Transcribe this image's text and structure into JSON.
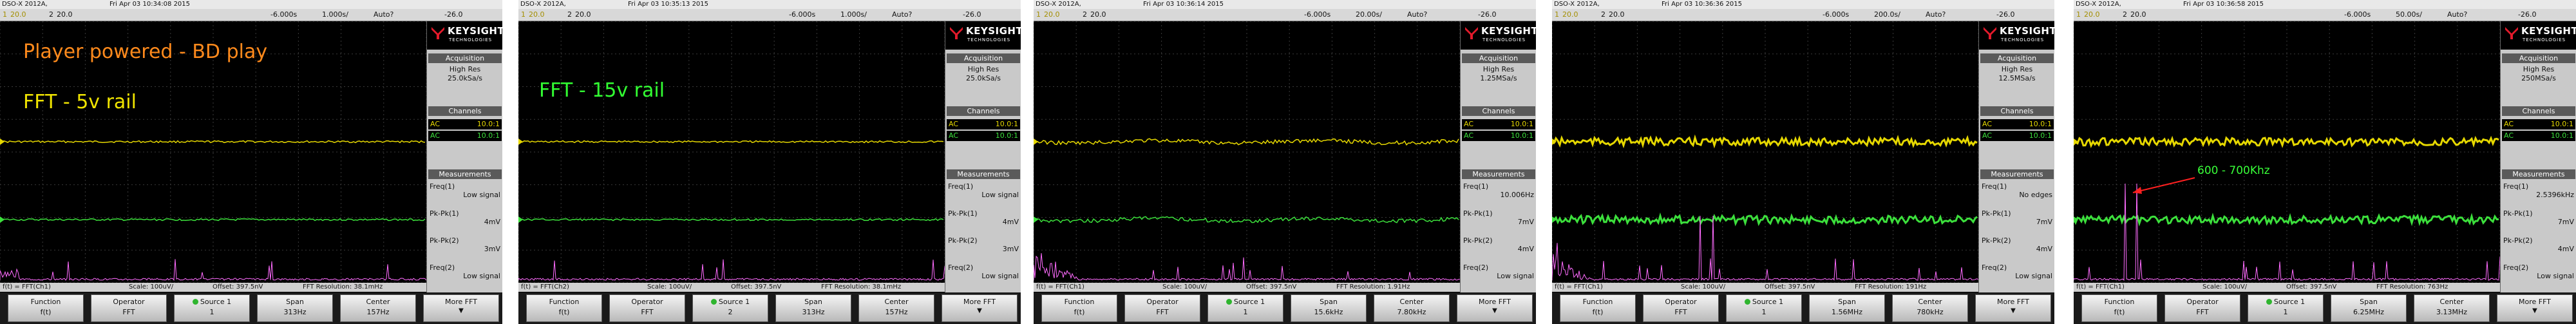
{
  "screens": [
    {
      "status": {
        "model": "DSO-X 2012A,",
        "datetime": "Fri Apr 03 10:34:08 2015"
      },
      "topbar": {
        "ch1": "1",
        "ch1_scale": "20.0",
        "ch2": "2",
        "ch2_scale": "20.0",
        "time_pos": "-6.000s",
        "time_scale": "1.000s/",
        "trigger": "Auto?",
        "trig_level": "-26.0"
      },
      "notes": [
        {
          "text": "Player powered - BD play",
          "color": "orange"
        },
        {
          "text": "FFT - 5v rail",
          "color": "yellow"
        }
      ],
      "peak_label": "",
      "bottom": {
        "channel": "f(t) = FFT(Ch1)",
        "scale": "Scale: 100uV/",
        "offset": "Offset: 397.5nV",
        "resolution": "FFT Resolution: 38.1mHz"
      },
      "softkeys": {
        "function_label": "Function",
        "function_value": "f(t)",
        "operator_label": "Operator",
        "operator_value": "FFT",
        "source_label": "Source 1",
        "source_value": "1",
        "span_label": "Span",
        "span_value": "313Hz",
        "center_label": "Center",
        "center_value": "157Hz",
        "more_label": "More FFT"
      },
      "side": {
        "acq_title": "Acquisition",
        "acq_mode": "High Res",
        "acq_rate": "25.0kSa/s",
        "chan_title": "Channels",
        "channels": [
          {
            "coupling": "AC",
            "value": "10.0:1"
          },
          {
            "coupling": "AC",
            "value": "10.0:1"
          }
        ],
        "meas_title": "Measurements",
        "meas": [
          {
            "name": "Freq(1)",
            "value": "Low signal"
          },
          {
            "name": "Pk-Pk(1)",
            "value": "4mV"
          },
          {
            "name": "Pk-Pk(2)",
            "value": "3mV"
          },
          {
            "name": "Freq(2)",
            "value": "Low signal"
          }
        ]
      }
    },
    {
      "status": {
        "model": "DSO-X 2012A,",
        "datetime": "Fri Apr 03 10:35:13 2015"
      },
      "topbar": {
        "ch1": "1",
        "ch1_scale": "20.0",
        "ch2": "2",
        "ch2_scale": "20.0",
        "time_pos": "-6.000s",
        "time_scale": "1.000s/",
        "trigger": "Auto?",
        "trig_level": "-26.0"
      },
      "notes": [
        {
          "text": "FFT - 15v rail",
          "color": "green"
        }
      ],
      "peak_label": "",
      "bottom": {
        "channel": "f(t) = FFT(Ch2)",
        "scale": "Scale: 100uV/",
        "offset": "Offset: 397.5nV",
        "resolution": "FFT Resolution: 38.1mHz"
      },
      "softkeys": {
        "function_label": "Function",
        "function_value": "f(t)",
        "operator_label": "Operator",
        "operator_value": "FFT",
        "source_label": "Source 1",
        "source_value": "2",
        "span_label": "Span",
        "span_value": "313Hz",
        "center_label": "Center",
        "center_value": "157Hz",
        "more_label": "More FFT"
      },
      "side": {
        "acq_title": "Acquisition",
        "acq_mode": "High Res",
        "acq_rate": "25.0kSa/s",
        "chan_title": "Channels",
        "channels": [
          {
            "coupling": "AC",
            "value": "10.0:1"
          },
          {
            "coupling": "AC",
            "value": "10.0:1"
          }
        ],
        "meas_title": "Measurements",
        "meas": [
          {
            "name": "Freq(1)",
            "value": "Low signal"
          },
          {
            "name": "Pk-Pk(1)",
            "value": "4mV"
          },
          {
            "name": "Pk-Pk(2)",
            "value": "3mV"
          },
          {
            "name": "Freq(2)",
            "value": "Low signal"
          }
        ]
      }
    },
    {
      "status": {
        "model": "DSO-X 2012A,",
        "datetime": "Fri Apr 03 10:36:14 2015"
      },
      "topbar": {
        "ch1": "1",
        "ch1_scale": "20.0",
        "ch2": "2",
        "ch2_scale": "20.0",
        "time_pos": "-6.000s",
        "time_scale": "20.00s/",
        "trigger": "Auto?",
        "trig_level": "-26.0"
      },
      "notes": [],
      "peak_label": "",
      "bottom": {
        "channel": "f(t) = FFT(Ch1)",
        "scale": "Scale: 100uV/",
        "offset": "Offset: 397.5nV",
        "resolution": "FFT Resolution: 1.91Hz"
      },
      "softkeys": {
        "function_label": "Function",
        "function_value": "f(t)",
        "operator_label": "Operator",
        "operator_value": "FFT",
        "source_label": "Source 1",
        "source_value": "1",
        "span_label": "Span",
        "span_value": "15.6kHz",
        "center_label": "Center",
        "center_value": "7.80kHz",
        "more_label": "More FFT"
      },
      "side": {
        "acq_title": "Acquisition",
        "acq_mode": "High Res",
        "acq_rate": "1.25MSa/s",
        "chan_title": "Channels",
        "channels": [
          {
            "coupling": "AC",
            "value": "10.0:1"
          },
          {
            "coupling": "AC",
            "value": "10.0:1"
          }
        ],
        "meas_title": "Measurements",
        "meas": [
          {
            "name": "Freq(1)",
            "value": "10.006Hz"
          },
          {
            "name": "Pk-Pk(1)",
            "value": "7mV"
          },
          {
            "name": "Pk-Pk(2)",
            "value": "4mV"
          },
          {
            "name": "Freq(2)",
            "value": "Low signal"
          }
        ]
      }
    },
    {
      "status": {
        "model": "DSO-X 2012A,",
        "datetime": "Fri Apr 03 10:36:36 2015"
      },
      "topbar": {
        "ch1": "1",
        "ch1_scale": "20.0",
        "ch2": "2",
        "ch2_scale": "20.0",
        "time_pos": "-6.000s",
        "time_scale": "200.0s/",
        "trigger": "Auto?",
        "trig_level": "-26.0"
      },
      "notes": [],
      "peak_label": "",
      "bottom": {
        "channel": "f(t) = FFT(Ch1)",
        "scale": "Scale: 100uV/",
        "offset": "Offset: 397.5nV",
        "resolution": "FFT Resolution: 191Hz"
      },
      "softkeys": {
        "function_label": "Function",
        "function_value": "f(t)",
        "operator_label": "Operator",
        "operator_value": "FFT",
        "source_label": "Source 1",
        "source_value": "1",
        "span_label": "Span",
        "span_value": "1.56MHz",
        "center_label": "Center",
        "center_value": "780kHz",
        "more_label": "More FFT"
      },
      "side": {
        "acq_title": "Acquisition",
        "acq_mode": "High Res",
        "acq_rate": "12.5MSa/s",
        "chan_title": "Channels",
        "channels": [
          {
            "coupling": "AC",
            "value": "10.0:1"
          },
          {
            "coupling": "AC",
            "value": "10.0:1"
          }
        ],
        "meas_title": "Measurements",
        "meas": [
          {
            "name": "Freq(1)",
            "value": "No edges"
          },
          {
            "name": "Pk-Pk(1)",
            "value": "7mV"
          },
          {
            "name": "Pk-Pk(2)",
            "value": "4mV"
          },
          {
            "name": "Freq(2)",
            "value": "Low signal"
          }
        ]
      }
    },
    {
      "status": {
        "model": "DSO-X 2012A,",
        "datetime": "Fri Apr 03 10:36:58 2015"
      },
      "topbar": {
        "ch1": "1",
        "ch1_scale": "20.0",
        "ch2": "2",
        "ch2_scale": "20.0",
        "time_pos": "-6.000s",
        "time_scale": "50.00s/",
        "trigger": "Auto?",
        "trig_level": "-26.0"
      },
      "notes": [],
      "peak_label": "600 - 700Khz",
      "bottom": {
        "channel": "f(t) = FFT(Ch1)",
        "scale": "Scale: 100uV/",
        "offset": "Offset: 397.5nV",
        "resolution": "FFT Resolution: 763Hz"
      },
      "softkeys": {
        "function_label": "Function",
        "function_value": "f(t)",
        "operator_label": "Operator",
        "operator_value": "FFT",
        "source_label": "Source 1",
        "source_value": "1",
        "span_label": "Span",
        "span_value": "6.25MHz",
        "center_label": "Center",
        "center_value": "3.13MHz",
        "more_label": "More FFT"
      },
      "side": {
        "acq_title": "Acquisition",
        "acq_mode": "High Res",
        "acq_rate": "250MSa/s",
        "chan_title": "Channels",
        "channels": [
          {
            "coupling": "AC",
            "value": "10.0:1"
          },
          {
            "coupling": "AC",
            "value": "10.0:1"
          }
        ],
        "meas_title": "Measurements",
        "meas": [
          {
            "name": "Freq(1)",
            "value": "2.5396kHz"
          },
          {
            "name": "Pk-Pk(1)",
            "value": "7mV"
          },
          {
            "name": "Pk-Pk(2)",
            "value": "4mV"
          },
          {
            "name": "Freq(2)",
            "value": "Low signal"
          }
        ]
      }
    }
  ],
  "brand": {
    "name": "KEYSIGHT",
    "sub": "TECHNOLOGIES"
  },
  "colors": {
    "ch1_trace": "#e6d800",
    "ch2_trace": "#3ce03c",
    "fft_trace": "#ff6cff",
    "grid": "#3a3a3a",
    "annotation_arrow": "#ff2020"
  }
}
